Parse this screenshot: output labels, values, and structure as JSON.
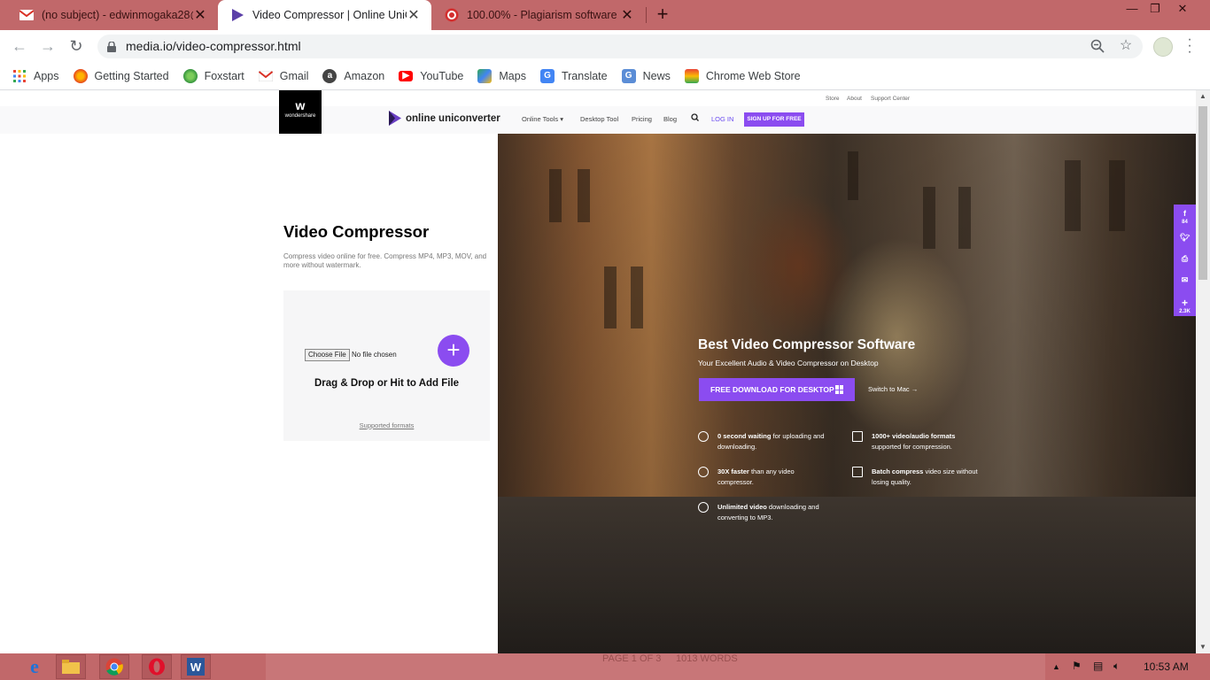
{
  "browser": {
    "tabs": [
      {
        "title": "(no subject) - edwinmogaka28@",
        "icon": "gmail-icon"
      },
      {
        "title": "Video Compressor | Online UniCo",
        "icon": "uniconverter-icon",
        "active": true
      },
      {
        "title": "100.00% - Plagiarism software fre",
        "icon": "plagiarism-icon"
      }
    ],
    "address": "media.io/video-compressor.html",
    "bookmarks": [
      {
        "label": "Apps",
        "icon": "apps-grid-icon"
      },
      {
        "label": "Getting Started",
        "icon": "firefox-icon"
      },
      {
        "label": "Foxstart",
        "icon": "globe-icon"
      },
      {
        "label": "Gmail",
        "icon": "gmail-icon"
      },
      {
        "label": "Amazon",
        "icon": "amazon-icon"
      },
      {
        "label": "YouTube",
        "icon": "youtube-icon"
      },
      {
        "label": "Maps",
        "icon": "maps-icon"
      },
      {
        "label": "Translate",
        "icon": "translate-icon"
      },
      {
        "label": "News",
        "icon": "news-icon"
      },
      {
        "label": "Chrome Web Store",
        "icon": "webstore-icon"
      }
    ]
  },
  "site": {
    "util_links": [
      "Store",
      "About",
      "Support Center"
    ],
    "logo_text": "wondershare",
    "brand": "online uniconverter",
    "nav": {
      "online_tools": "Online Tools",
      "desktop_tool": "Desktop Tool",
      "pricing": "Pricing",
      "blog": "Blog",
      "login": "LOG IN",
      "signup": "SIGN UP FOR FREE"
    }
  },
  "tool": {
    "title": "Video Compressor",
    "subtitle": "Compress video online for free. Compress MP4, MP3, MOV, and more without watermark.",
    "choose_file": "Choose File",
    "no_file": "No file chosen",
    "plus": "+",
    "drop_text": "Drag & Drop or Hit to Add File",
    "formats_link": "Supported formats"
  },
  "hero": {
    "title": "Best Video Compressor Software",
    "subtitle": "Your Excellent Audio & Video Compressor on Desktop",
    "download": "FREE DOWNLOAD FOR DESKTOP",
    "switch": "Switch to Mac →",
    "features": [
      {
        "bold": "0 second waiting",
        "rest": " for uploading and downloading."
      },
      {
        "bold": "1000+ video/audio formats",
        "rest": " supported for compression."
      },
      {
        "bold": "30X faster",
        "rest": " than any video compressor."
      },
      {
        "bold": "Batch compress",
        "rest": " video size without losing quality."
      },
      {
        "bold": "Unlimited video",
        "rest": " downloading and converting to MP3."
      }
    ]
  },
  "share": {
    "facebook_count": "84",
    "total_count": "2.3K"
  },
  "taskbar": {
    "ghost_texts": [
      "PAGE 1 OF 3",
      "1013 WORDS"
    ],
    "time": "10:53 AM"
  },
  "colors": {
    "accent": "#8b4cf0",
    "chrome_frame": "#c1686a"
  }
}
